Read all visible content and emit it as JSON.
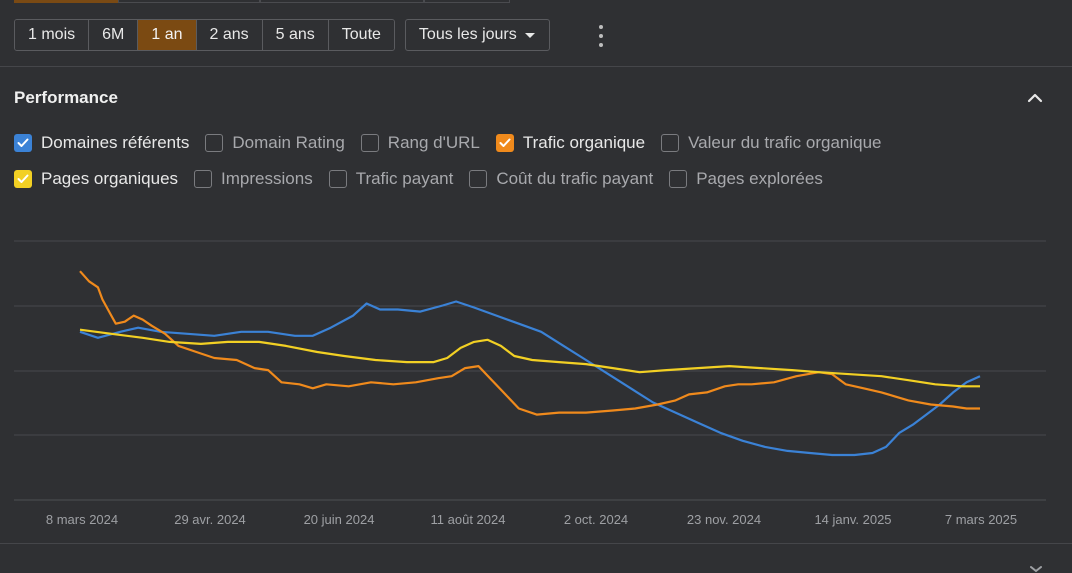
{
  "range": {
    "options": [
      "1 mois",
      "6M",
      "1 an",
      "2 ans",
      "5 ans",
      "Toute"
    ],
    "active_index": 2
  },
  "frequency": {
    "selected": "Tous les jours"
  },
  "section": {
    "title": "Performance"
  },
  "metrics": [
    {
      "label": "Domaines référents",
      "checked": true,
      "color": "#3b82d6"
    },
    {
      "label": "Domain Rating",
      "checked": false
    },
    {
      "label": "Rang d'URL",
      "checked": false
    },
    {
      "label": "Trafic organique",
      "checked": true,
      "color": "#f08a1c"
    },
    {
      "label": "Valeur du trafic organique",
      "checked": false
    },
    {
      "label": "Pages organiques",
      "checked": true,
      "color": "#f2d024"
    },
    {
      "label": "Impressions",
      "checked": false
    },
    {
      "label": "Trafic payant",
      "checked": false
    },
    {
      "label": "Coût du trafic payant",
      "checked": false
    },
    {
      "label": "Pages explorées",
      "checked": false
    }
  ],
  "chart_data": {
    "type": "line",
    "x_ticks": [
      "8 mars 2024",
      "29 avr. 2024",
      "20 juin 2024",
      "11 août 2024",
      "2 oct. 2024",
      "23 nov. 2024",
      "14 janv. 2025",
      "7 mars 2025"
    ],
    "x_start": "2024-03-08",
    "x_end": "2025-03-07",
    "y_hidden": true,
    "ylim": [
      0,
      100
    ],
    "grid": true,
    "series": [
      {
        "color": "#3b82d6",
        "points": [
          [
            0,
            62
          ],
          [
            8,
            59
          ],
          [
            18,
            62
          ],
          [
            26,
            64
          ],
          [
            36,
            62
          ],
          [
            48,
            61
          ],
          [
            60,
            60
          ],
          [
            72,
            62
          ],
          [
            84,
            62
          ],
          [
            96,
            60
          ],
          [
            104,
            60
          ],
          [
            112,
            64
          ],
          [
            122,
            70
          ],
          [
            128,
            76
          ],
          [
            134,
            73
          ],
          [
            142,
            73
          ],
          [
            152,
            72
          ],
          [
            162,
            75
          ],
          [
            168,
            77
          ],
          [
            176,
            74
          ],
          [
            186,
            70
          ],
          [
            196,
            66
          ],
          [
            206,
            62
          ],
          [
            216,
            55
          ],
          [
            226,
            48
          ],
          [
            236,
            41
          ],
          [
            246,
            34
          ],
          [
            256,
            27
          ],
          [
            266,
            22
          ],
          [
            276,
            17
          ],
          [
            286,
            12
          ],
          [
            296,
            8
          ],
          [
            306,
            5
          ],
          [
            316,
            3
          ],
          [
            326,
            2
          ],
          [
            336,
            1
          ],
          [
            346,
            1
          ],
          [
            354,
            2
          ],
          [
            360,
            5
          ],
          [
            366,
            12
          ],
          [
            372,
            16
          ],
          [
            378,
            21
          ],
          [
            384,
            26
          ],
          [
            390,
            32
          ],
          [
            396,
            37
          ],
          [
            402,
            40
          ]
        ]
      },
      {
        "color": "#f08a1c",
        "points": [
          [
            0,
            92
          ],
          [
            4,
            87
          ],
          [
            8,
            84
          ],
          [
            10,
            78
          ],
          [
            14,
            70
          ],
          [
            16,
            66
          ],
          [
            20,
            67
          ],
          [
            24,
            70
          ],
          [
            28,
            68
          ],
          [
            32,
            65
          ],
          [
            38,
            61
          ],
          [
            44,
            55
          ],
          [
            52,
            52
          ],
          [
            60,
            49
          ],
          [
            70,
            48
          ],
          [
            78,
            44
          ],
          [
            84,
            43
          ],
          [
            90,
            37
          ],
          [
            98,
            36
          ],
          [
            104,
            34
          ],
          [
            110,
            36
          ],
          [
            120,
            35
          ],
          [
            130,
            37
          ],
          [
            140,
            36
          ],
          [
            150,
            37
          ],
          [
            160,
            39
          ],
          [
            166,
            40
          ],
          [
            172,
            44
          ],
          [
            178,
            45
          ],
          [
            184,
            38
          ],
          [
            190,
            31
          ],
          [
            196,
            24
          ],
          [
            204,
            21
          ],
          [
            214,
            22
          ],
          [
            226,
            22
          ],
          [
            238,
            23
          ],
          [
            248,
            24
          ],
          [
            258,
            26
          ],
          [
            266,
            28
          ],
          [
            272,
            31
          ],
          [
            280,
            32
          ],
          [
            288,
            35
          ],
          [
            294,
            36
          ],
          [
            300,
            36
          ],
          [
            310,
            37
          ],
          [
            320,
            40
          ],
          [
            330,
            42
          ],
          [
            336,
            41
          ],
          [
            342,
            36
          ],
          [
            350,
            34
          ],
          [
            358,
            32
          ],
          [
            364,
            30
          ],
          [
            370,
            28
          ],
          [
            380,
            26
          ],
          [
            390,
            25
          ],
          [
            396,
            24
          ],
          [
            402,
            24
          ]
        ]
      },
      {
        "color": "#f2d024",
        "points": [
          [
            0,
            63
          ],
          [
            14,
            61
          ],
          [
            28,
            59
          ],
          [
            40,
            57
          ],
          [
            54,
            56
          ],
          [
            66,
            57
          ],
          [
            80,
            57
          ],
          [
            92,
            55
          ],
          [
            106,
            52
          ],
          [
            118,
            50
          ],
          [
            132,
            48
          ],
          [
            146,
            47
          ],
          [
            158,
            47
          ],
          [
            164,
            49
          ],
          [
            170,
            54
          ],
          [
            176,
            57
          ],
          [
            182,
            58
          ],
          [
            188,
            55
          ],
          [
            194,
            50
          ],
          [
            202,
            48
          ],
          [
            214,
            47
          ],
          [
            226,
            46
          ],
          [
            238,
            44
          ],
          [
            250,
            42
          ],
          [
            262,
            43
          ],
          [
            276,
            44
          ],
          [
            290,
            45
          ],
          [
            304,
            44
          ],
          [
            318,
            43
          ],
          [
            330,
            42
          ],
          [
            344,
            41
          ],
          [
            358,
            40
          ],
          [
            370,
            38
          ],
          [
            382,
            36
          ],
          [
            394,
            35
          ],
          [
            402,
            35
          ]
        ]
      }
    ]
  }
}
